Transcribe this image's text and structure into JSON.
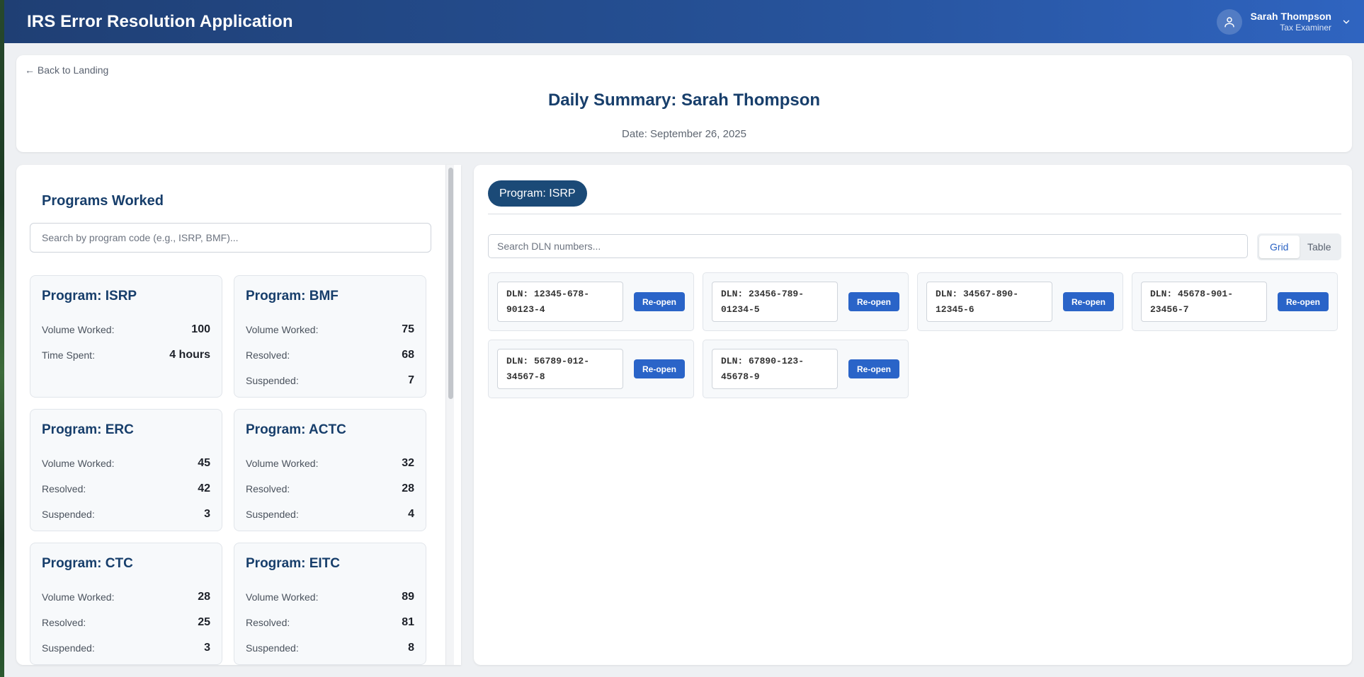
{
  "app": {
    "title": "IRS Error Resolution Application"
  },
  "user": {
    "name": "Sarah Thompson",
    "role": "Tax Examiner"
  },
  "header": {
    "back_label": "← Back to Landing",
    "title": "Daily Summary: Sarah Thompson",
    "date": "Date: September 26, 2025"
  },
  "programs": {
    "section_title": "Programs Worked",
    "search_placeholder": "Search by program code (e.g., ISRP, BMF)...",
    "cards": [
      {
        "title": "Program: ISRP",
        "stats": [
          {
            "label": "Volume Worked:",
            "value": "100"
          },
          {
            "label": "Time Spent:",
            "value": "4 hours"
          }
        ]
      },
      {
        "title": "Program: BMF",
        "stats": [
          {
            "label": "Volume Worked:",
            "value": "75"
          },
          {
            "label": "Resolved:",
            "value": "68"
          },
          {
            "label": "Suspended:",
            "value": "7"
          }
        ]
      },
      {
        "title": "Program: ERC",
        "stats": [
          {
            "label": "Volume Worked:",
            "value": "45"
          },
          {
            "label": "Resolved:",
            "value": "42"
          },
          {
            "label": "Suspended:",
            "value": "3"
          }
        ]
      },
      {
        "title": "Program: ACTC",
        "stats": [
          {
            "label": "Volume Worked:",
            "value": "32"
          },
          {
            "label": "Resolved:",
            "value": "28"
          },
          {
            "label": "Suspended:",
            "value": "4"
          }
        ]
      },
      {
        "title": "Program: CTC",
        "stats": [
          {
            "label": "Volume Worked:",
            "value": "28"
          },
          {
            "label": "Resolved:",
            "value": "25"
          },
          {
            "label": "Suspended:",
            "value": "3"
          }
        ]
      },
      {
        "title": "Program: EITC",
        "stats": [
          {
            "label": "Volume Worked:",
            "value": "89"
          },
          {
            "label": "Resolved:",
            "value": "81"
          },
          {
            "label": "Suspended:",
            "value": "8"
          }
        ]
      }
    ]
  },
  "detail": {
    "program_label": "Program: ISRP",
    "search_placeholder": "Search DLN numbers...",
    "view_toggle": {
      "grid": "Grid",
      "table": "Table",
      "active": "grid"
    },
    "dlns": [
      {
        "text": "DLN: 12345-678-90123-4",
        "action": "Re-open"
      },
      {
        "text": "DLN: 23456-789-01234-5",
        "action": "Re-open"
      },
      {
        "text": "DLN: 34567-890-12345-6",
        "action": "Re-open"
      },
      {
        "text": "DLN: 45678-901-23456-7",
        "action": "Re-open"
      },
      {
        "text": "DLN: 56789-012-34567-8",
        "action": "Re-open"
      },
      {
        "text": "DLN: 67890-123-45678-9",
        "action": "Re-open"
      }
    ]
  },
  "colors": {
    "header_gradient_start": "#1f3f74",
    "header_gradient_end": "#2f64c0",
    "heading_navy": "#173e6b",
    "pill_navy": "#1b4a77",
    "button_blue": "#2a64c8"
  },
  "icons": {
    "avatar": "user-icon",
    "menu": "chevron-down-icon"
  }
}
